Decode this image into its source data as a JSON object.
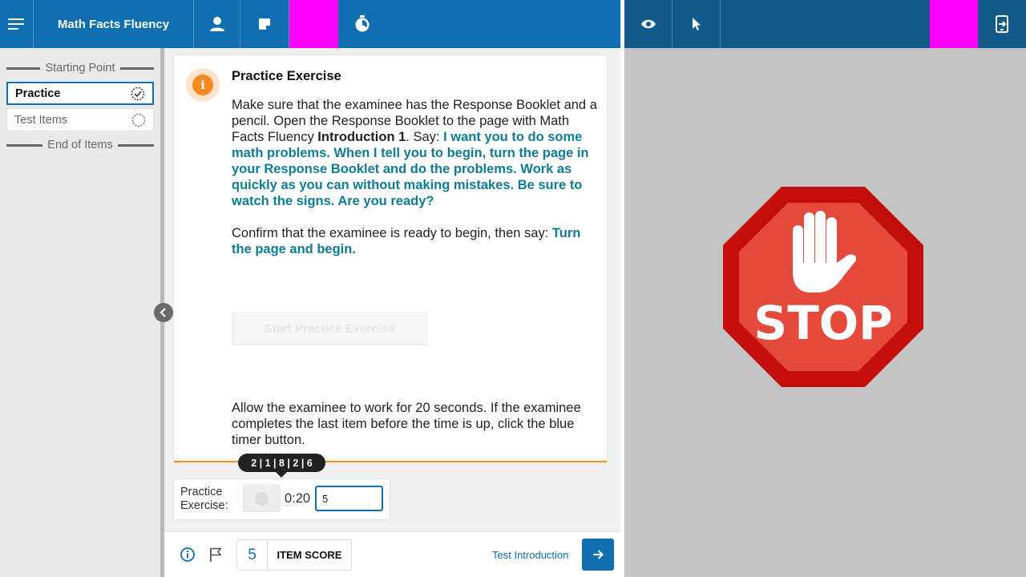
{
  "header": {
    "title": "Math Facts Fluency",
    "icons": [
      "hamburger-menu-icon",
      "user-icon",
      "note-icon",
      "timer-icon"
    ],
    "right_icons": [
      "eye-icon",
      "pointer-icon",
      "exit-to-device-icon"
    ],
    "highlight_color": "#ff00ff"
  },
  "sidebar": {
    "start_label": "Starting Point",
    "items": [
      {
        "label": "Practice",
        "status_icon": "progress-check-icon",
        "active": true
      },
      {
        "label": "Test Items",
        "status_icon": "progress-empty-icon",
        "active": false
      }
    ],
    "end_label": "End of Items"
  },
  "card": {
    "title": "Practice Exercise",
    "p1_plain": "Make sure that the examinee has the Response Booklet and a pencil. Open the Response Booklet to the page with Math Facts Fluency ",
    "p1_bold": "Introduction 1",
    "p1_say": ". Say: ",
    "p1_script": "I want you to do some math problems. When I tell you to begin, turn the page in your Response Booklet and do the problems. Work as quickly as you can without making mistakes. Be sure to watch the signs. Are you ready?",
    "p2_plain": "Confirm that the examinee is ready to begin, then say: ",
    "p2_script": "Turn the page and begin.",
    "start_button": "Start Practice Exercise",
    "p3": "Allow the examinee to work for 20 seconds. If the examinee completes the last item before the time is up, click the blue timer button."
  },
  "tooltip": "2 | 1 | 8 | 2 | 6",
  "timer": {
    "label": "Practice Exercise:",
    "time": "0:20",
    "input_value": "5"
  },
  "bottom": {
    "score_value": "5",
    "score_label": "ITEM SCORE",
    "next_label": "Test Introduction"
  },
  "stop_sign": {
    "text": "STOP",
    "outer_color": "#c40d0d",
    "inner_color": "#e34a3c"
  },
  "colors": {
    "header_left": "#0f6fb0",
    "header_right": "#125a8a",
    "accent_teal": "#0e7c95",
    "accent_orange": "#f5891f"
  }
}
